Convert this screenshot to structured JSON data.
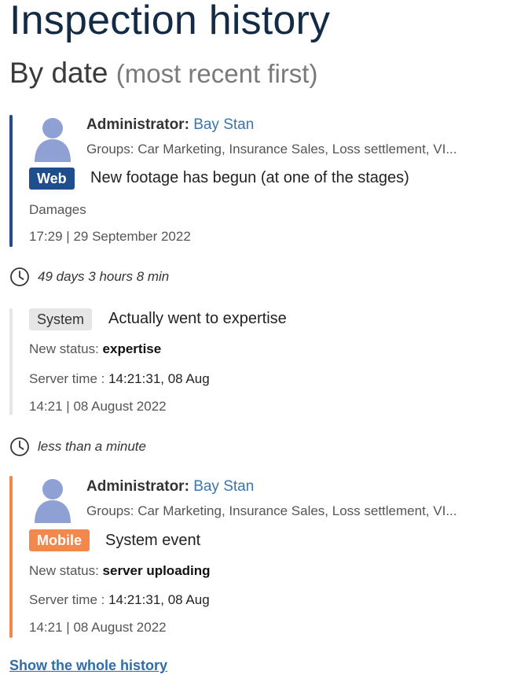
{
  "page": {
    "title": "Inspection history",
    "subtitle": "By date",
    "subtitle_note": "(most recent first)"
  },
  "entries": [
    {
      "bar_color": "#1e4f8c",
      "admin_role": "Administrator:",
      "admin_name": "Bay Stan",
      "groups": "Groups: Car  Marketing, Insurance Sales, Loss settlement, VI...",
      "badge": "Web",
      "event": "New footage has begun (at one of the stages)",
      "detail": "Damages",
      "time": "17:29",
      "date": "29 September 2022"
    },
    {
      "bar_color": "#e6e6e6",
      "badge": "System",
      "event": "Actually went to expertise",
      "status_label": "New status:",
      "status_value": "expertise",
      "server_label": "Server time :",
      "server_value": "14:21:31, 08 Aug",
      "time": "14:21",
      "date": "08 August 2022"
    },
    {
      "bar_color": "#f3884d",
      "admin_role": "Administrator:",
      "admin_name": "Bay Stan",
      "groups": "Groups: Car Marketing, Insurance Sales, Loss settlement, VI...",
      "badge": "Mobile",
      "event": "System event",
      "status_label": "New status:",
      "status_value": "server uploading",
      "server_label": "Server time :",
      "server_value": "14:21:31, 08 Aug",
      "time": "14:21",
      "date": "08 August 2022"
    }
  ],
  "gaps": [
    {
      "icon": "clock-icon",
      "text": "49 days 3 hours 8 min"
    },
    {
      "icon": "clock-icon",
      "text": "less than a minute"
    }
  ],
  "separator": "|",
  "footer": {
    "show_all": "Show the whole history"
  }
}
